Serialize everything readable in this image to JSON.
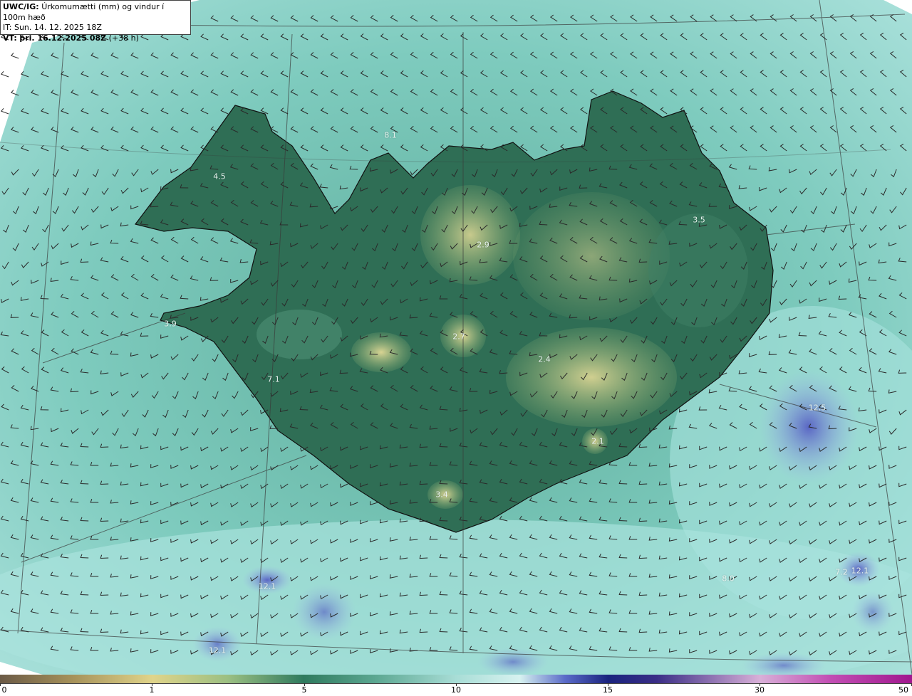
{
  "info": {
    "model": "UWC/IG:",
    "field": "Úrkomumætti (mm) og vindur í 100m hæð",
    "init_time": "IT: Sun. 14. 12. 2025 18Z",
    "valid_prefix": "VT:",
    "valid_time": "þri. 16.12.2025 08Z",
    "lead": "(+38 h)"
  },
  "map_labels": [
    {
      "id": "westfjords",
      "text": "4.5"
    },
    {
      "id": "north-sea",
      "text": "8.1"
    },
    {
      "id": "north-central",
      "text": "2.9"
    },
    {
      "id": "east",
      "text": "3.5"
    },
    {
      "id": "snaefellsnes",
      "text": "3.9"
    },
    {
      "id": "langjokull",
      "text": "2.7"
    },
    {
      "id": "vatnajokull",
      "text": "2.4"
    },
    {
      "id": "reykjanes",
      "text": "7.1"
    },
    {
      "id": "oraefajokull",
      "text": "2.1"
    },
    {
      "id": "myrdalsjokull",
      "text": "3.4"
    },
    {
      "id": "se-sea",
      "text": "12.5"
    },
    {
      "id": "sw-sea-a",
      "text": "12.1"
    },
    {
      "id": "sw-sea-b",
      "text": "12.1"
    },
    {
      "id": "s-sea",
      "text": "8.0"
    },
    {
      "id": "se-sea-b",
      "text": "7.2"
    },
    {
      "id": "se-sea-c",
      "text": "12.1"
    }
  ],
  "colorbar": {
    "ticks": [
      "0",
      "1",
      "5",
      "10",
      "15",
      "30",
      "50"
    ]
  },
  "colors": {
    "land_low": "#2f6e55",
    "land_high": "#c9c98a",
    "sea": "#7ecbbe",
    "heavy_precip": "#6f7fd0",
    "coastline": "#111111",
    "barbs": "#2a2a2a"
  }
}
